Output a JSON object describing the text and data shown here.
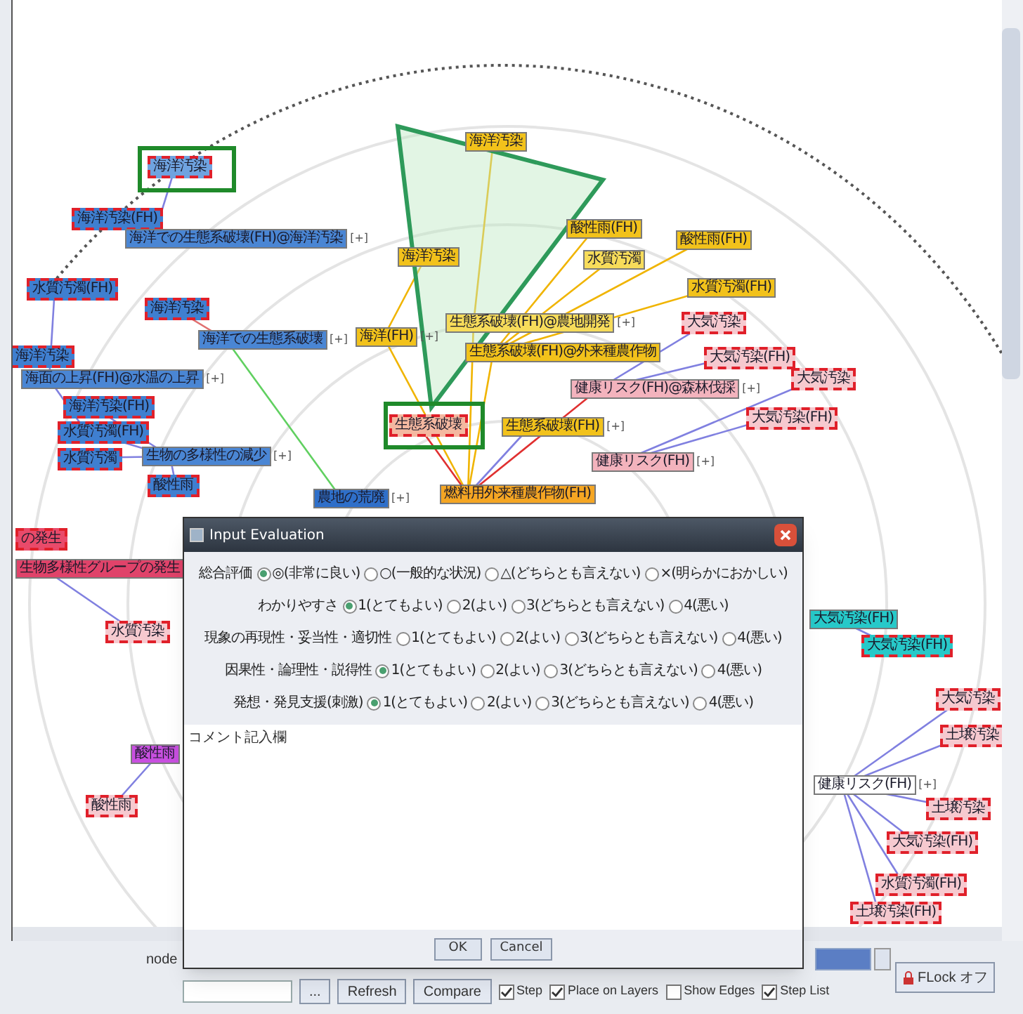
{
  "graph": {
    "nodes": [
      {
        "text": "海洋汚染",
        "color": "#6fa3e0",
        "dashed": true
      },
      {
        "text": "海洋汚染(FH)",
        "color": "#3f7fd0",
        "dashed": true
      },
      {
        "text": "海洋での生態系破壊(FH)@海洋汚染",
        "color": "#4a86d4",
        "dashed": false,
        "mark": "[+]"
      },
      {
        "text": "水質汚濁(FH)",
        "color": "#3f7fd0",
        "dashed": true
      },
      {
        "text": "海洋汚染",
        "color": "#3f7fd0",
        "dashed": true
      },
      {
        "text": "海洋での生態系破壊",
        "color": "#4a86d4",
        "dashed": false,
        "mark": "[+]"
      },
      {
        "text": "海洋汚染",
        "color": "#3f7fd0",
        "dashed": true
      },
      {
        "text": "海面の上昇(FH)@水温の上昇",
        "color": "#4a86d4",
        "dashed": false,
        "mark": "[+]"
      },
      {
        "text": "海洋汚染(FH)",
        "color": "#3f7fd0",
        "dashed": true
      },
      {
        "text": "水質汚濁(FH)",
        "color": "#3f7fd0",
        "dashed": true
      },
      {
        "text": "水質汚濁",
        "color": "#3f7fd0",
        "dashed": true
      },
      {
        "text": "生物の多様性の減少",
        "color": "#4a86d4",
        "dashed": false,
        "mark": "[+]"
      },
      {
        "text": "酸性雨",
        "color": "#3f7fd0",
        "dashed": true
      },
      {
        "text": "農地の荒廃",
        "color": "#2f6fc9",
        "dashed": false,
        "mark": "[+]"
      },
      {
        "text": "海洋汚染",
        "color": "#f2c21b",
        "dashed": false
      },
      {
        "text": "酸性雨(FH)",
        "color": "#f2c21b",
        "dashed": false
      },
      {
        "text": "酸性雨(FH)",
        "color": "#f2c21b",
        "dashed": false
      },
      {
        "text": "海洋汚染",
        "color": "#f2c21b",
        "dashed": false
      },
      {
        "text": "水質汚濁",
        "color": "#f7dc5a",
        "dashed": false
      },
      {
        "text": "水質汚濁(FH)",
        "color": "#f2c21b",
        "dashed": false
      },
      {
        "text": "生態系破壊(FH)@農地開発",
        "color": "#f7dc5a",
        "dashed": false,
        "mark": "[+]"
      },
      {
        "text": "海洋(FH)",
        "color": "#f2c21b",
        "dashed": false,
        "mark": "[+]"
      },
      {
        "text": "生態系破壊(FH)@外来種農作物",
        "color": "#f2c21b",
        "dashed": false
      },
      {
        "text": "生態系破壊",
        "color": "#f4b8a0",
        "dashed": true
      },
      {
        "text": "生態系破壊(FH)",
        "color": "#f2c21b",
        "dashed": false,
        "mark": "[+]"
      },
      {
        "text": "燃料用外来種農作物(FH)",
        "color": "#f5a623",
        "dashed": false
      },
      {
        "text": "大気汚染",
        "color": "#f6c9cf",
        "dashed": true
      },
      {
        "text": "大気汚染(FH)",
        "color": "#f6c9cf",
        "dashed": true
      },
      {
        "text": "健康リスク(FH)@森林伐採",
        "color": "#f3b3bd",
        "dashed": false,
        "mark": "[+]"
      },
      {
        "text": "大気汚染",
        "color": "#f6c9cf",
        "dashed": true
      },
      {
        "text": "大気汚染(FH)",
        "color": "#f6c9cf",
        "dashed": true
      },
      {
        "text": "健康リスク(FH)",
        "color": "#f3b3bd",
        "dashed": false,
        "mark": "[+]"
      },
      {
        "text": "の発生",
        "color": "#e94a6a",
        "dashed": true
      },
      {
        "text": "生物多様性グループの発生",
        "color": "#e0436a",
        "dashed": false
      },
      {
        "text": "水質汚染",
        "color": "#f6c9cf",
        "dashed": true
      },
      {
        "text": "酸性雨",
        "color": "#c84fe0",
        "dashed": false
      },
      {
        "text": "酸性雨",
        "color": "#f6c9cf",
        "dashed": true
      },
      {
        "text": "大気汚染(FH)",
        "color": "#27c9c9",
        "dashed": false
      },
      {
        "text": "大気汚染(FH)",
        "color": "#27c9c9",
        "dashed": true
      },
      {
        "text": "大気汚染",
        "color": "#f6c9cf",
        "dashed": true
      },
      {
        "text": "土壌汚染",
        "color": "#f6c9cf",
        "dashed": true
      },
      {
        "text": "健康リスク(FH)",
        "color": "#ffffff",
        "dashed": false,
        "mark": "[+]"
      },
      {
        "text": "土壌汚染",
        "color": "#f6c9cf",
        "dashed": true
      },
      {
        "text": "大気汚染(FH)",
        "color": "#f6c9cf",
        "dashed": true
      },
      {
        "text": "水質汚濁(FH)",
        "color": "#f6c9cf",
        "dashed": true
      },
      {
        "text": "土壌汚染(FH)",
        "color": "#f6c9cf",
        "dashed": true
      }
    ]
  },
  "dialog": {
    "title": "Input Evaluation",
    "rows": [
      {
        "label": "総合評価",
        "options": [
          {
            "label": "◎(非常に良い)",
            "selected": true
          },
          {
            "label": "○(一般的な状況)",
            "selected": false
          },
          {
            "label": "△(どちらとも言えない)",
            "selected": false
          },
          {
            "label": "×(明らかにおかしい)",
            "selected": false
          }
        ]
      },
      {
        "label": "わかりやすさ",
        "options": [
          {
            "label": "1(とてもよい)",
            "selected": true
          },
          {
            "label": "2(よい)",
            "selected": false
          },
          {
            "label": "3(どちらとも言えない)",
            "selected": false
          },
          {
            "label": "4(悪い)",
            "selected": false
          }
        ]
      },
      {
        "label": "現象の再現性・妥当性・適切性",
        "options": [
          {
            "label": "1(とてもよい)",
            "selected": false
          },
          {
            "label": "2(よい)",
            "selected": false
          },
          {
            "label": "3(どちらとも言えない)",
            "selected": false
          },
          {
            "label": "4(悪い)",
            "selected": false
          }
        ]
      },
      {
        "label": "因果性・論理性・説得性",
        "options": [
          {
            "label": "1(とてもよい)",
            "selected": true
          },
          {
            "label": "2(よい)",
            "selected": false
          },
          {
            "label": "3(どちらとも言えない)",
            "selected": false
          },
          {
            "label": "4(悪い)",
            "selected": false
          }
        ]
      },
      {
        "label": "発想・発見支援(刺激)",
        "options": [
          {
            "label": "1(とてもよい)",
            "selected": true
          },
          {
            "label": "2(よい)",
            "selected": false
          },
          {
            "label": "3(どちらとも言えない)",
            "selected": false
          },
          {
            "label": "4(悪い)",
            "selected": false
          }
        ]
      }
    ],
    "comment": {
      "placeholder": "コメント記入欄"
    },
    "buttons": [
      "OK",
      "Cancel"
    ]
  },
  "toolbar": {
    "node_label": "node",
    "more_button": "...",
    "refresh_button": "Refresh",
    "compare_button": "Compare",
    "checkboxes": [
      {
        "label": "Step",
        "checked": true
      },
      {
        "label": "Place on Layers",
        "checked": true
      },
      {
        "label": "Show Edges",
        "checked": false
      },
      {
        "label": "Step List",
        "checked": true
      }
    ],
    "lock_button": "FLock オフ"
  }
}
